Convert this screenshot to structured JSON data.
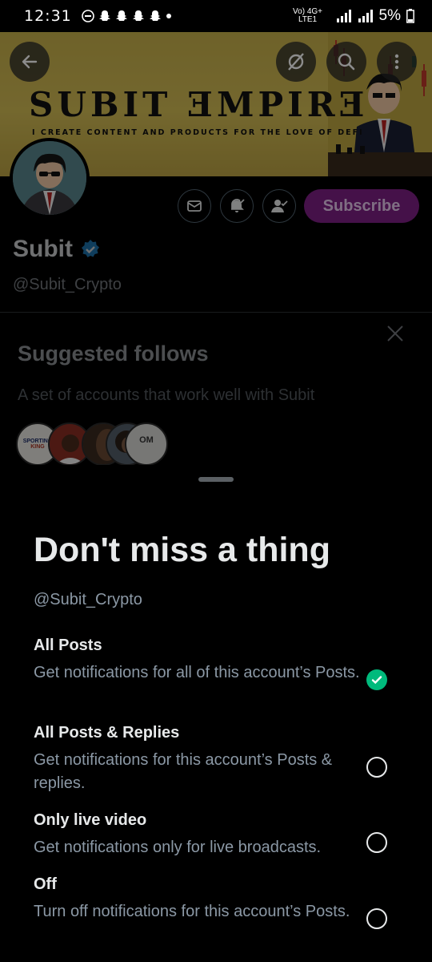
{
  "status_bar": {
    "time": "12:31",
    "network_label": "Vo) 4G+ LTE1",
    "battery": "5%"
  },
  "banner": {
    "title": "SUBIT ƎMPIRƎ",
    "subtitle": "I CREATE CONTENT AND PRODUCTS FOR THE LOVE OF DEFI"
  },
  "profile": {
    "name": "Subit",
    "handle": "@Subit_Crypto",
    "subscribe_label": "Subscribe"
  },
  "suggested": {
    "title": "Suggested follows",
    "subtitle": "A set of accounts that work well with Subit",
    "avatars": [
      {
        "label_top": "SPORTING",
        "label_bottom": "KING"
      },
      {
        "label_top": ""
      },
      {
        "label_top": ""
      },
      {
        "label_top": ""
      },
      {
        "label_top": "OM"
      }
    ]
  },
  "sheet": {
    "title": "Don't miss a thing",
    "handle": "@Subit_Crypto",
    "options": [
      {
        "label": "All Posts",
        "description": "Get notifications for all of this account’s Posts.",
        "selected": true
      },
      {
        "label": "All Posts & Replies",
        "description": "Get notifications for this account’s Posts & replies.",
        "selected": false
      },
      {
        "label": "Only live video",
        "description": "Get notifications only for live broadcasts.",
        "selected": false
      },
      {
        "label": "Off",
        "description": "Turn off notifications for this account’s Posts.",
        "selected": false
      }
    ]
  },
  "colors": {
    "accent_subscribe": "#7f1f86",
    "verified": "#1d9bf0",
    "check": "#00ba7c",
    "banner_gold": "#d3bd55"
  }
}
